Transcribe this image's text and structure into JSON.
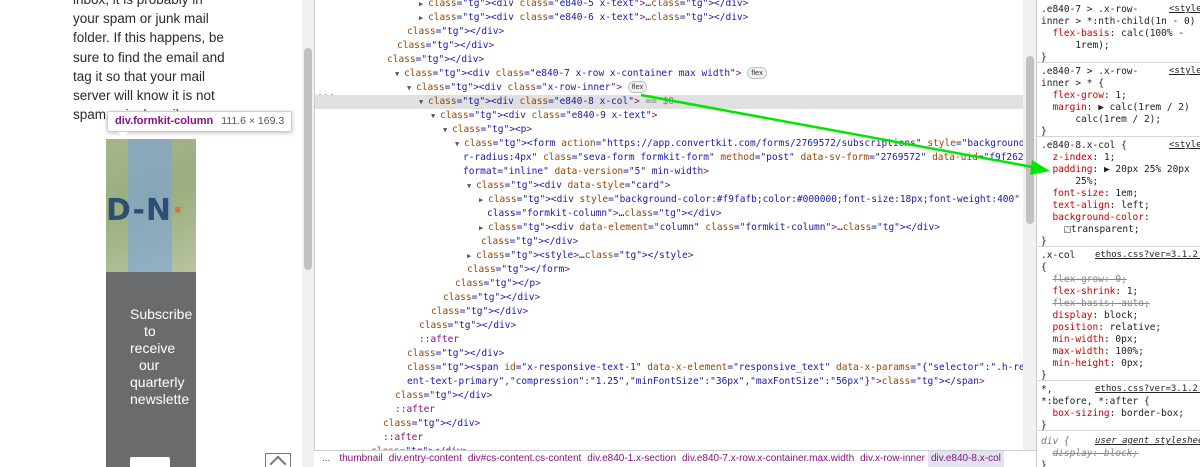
{
  "page": {
    "text_lines": [
      "inbox, it is probably in",
      "your spam or junk mail",
      "folder. If this happens, be",
      "sure to find the email and",
      "tag it so that your mail",
      "server will know it is not",
      "spam or junk mail."
    ],
    "tooltip_selector": "div.formkit-column",
    "tooltip_dims": "111.6 × 169.3",
    "image_text": "D-N",
    "image_text_end": "·",
    "embed_lines": [
      "Subscribe",
      "to",
      "receive",
      "our",
      "quarterly",
      "newslette"
    ],
    "colors": {
      "embed_bg": "#6a6b6d",
      "arrow": "#00e600"
    }
  },
  "elements": {
    "ellipsis": "···",
    "lines": [
      {
        "indent": 104,
        "tri": "▶",
        "html": "&lt;div class=&quot;e840-5 x-text&quot;&gt;…&lt;/div&gt;"
      },
      {
        "indent": 104,
        "tri": "▶",
        "html": "&lt;div class=&quot;e840-6 x-text&quot;&gt;…&lt;/div&gt;"
      },
      {
        "indent": 92,
        "tri": "",
        "html": "&lt;/div&gt;"
      },
      {
        "indent": 82,
        "tri": "",
        "html": "&lt;/div&gt;"
      },
      {
        "indent": 72,
        "tri": "",
        "html": "&lt;/div&gt;"
      },
      {
        "indent": 80,
        "tri": "▼",
        "html": "&lt;div class=&quot;e840-7 x-row x-container max width&quot;&gt;",
        "badge": "flex"
      },
      {
        "indent": 92,
        "tri": "▼",
        "html": "&lt;div class=&quot;x-row-inner&quot;&gt;",
        "badge": "flex"
      },
      {
        "indent": 104,
        "tri": "▼",
        "html": "&lt;div class=&quot;e840-8 x-col&quot;&gt;",
        "suffix": " == $0",
        "sel": true
      },
      {
        "indent": 116,
        "tri": "▼",
        "html": "&lt;div class=&quot;e840-9 x-text&quot;&gt;"
      },
      {
        "indent": 128,
        "tri": "▼",
        "html": "&lt;p&gt;"
      },
      {
        "indent": 140,
        "tri": "▼",
        "html": "&lt;form action=&quot;https://app.convertkit.com/forms/2769572/subscriptions&quot; style=&quot;background-color:#6a6b6d;borde"
      },
      {
        "indent": 148,
        "tri": "",
        "html": "r-radius:4px&quot; class=&quot;seva-form formkit-form&quot; method=&quot;post&quot; data-sv-form=&quot;2769572&quot; data-uid=&quot;f9f2627301&quot; data-"
      },
      {
        "indent": 148,
        "tri": "",
        "html": "format=&quot;inline&quot; data-version=&quot;5&quot; min-width&gt;"
      },
      {
        "indent": 152,
        "tri": "▼",
        "html": "&lt;div data-style=&quot;card&quot;&gt;"
      },
      {
        "indent": 164,
        "tri": "▶",
        "html": "&lt;div style=&quot;background-color:#f9fafb;color:#000000;font-size:18px;font-weight:400&quot; data-element=&quot;column&quot;"
      },
      {
        "indent": 172,
        "tri": "",
        "html": "class=&quot;formkit-column&quot;&gt;…&lt;/div&gt;"
      },
      {
        "indent": 164,
        "tri": "▶",
        "html": "&lt;div data-element=&quot;column&quot; class=&quot;formkit-column&quot;&gt;…&lt;/div&gt;"
      },
      {
        "indent": 166,
        "tri": "",
        "html": "&lt;/div&gt;"
      },
      {
        "indent": 152,
        "tri": "▶",
        "html": "&lt;style&gt;…&lt;/style&gt;"
      },
      {
        "indent": 152,
        "tri": "",
        "html": "&lt;/form&gt;"
      },
      {
        "indent": 140,
        "tri": "",
        "html": "&lt;/p&gt;"
      },
      {
        "indent": 128,
        "tri": "",
        "html": "&lt;/div&gt;"
      },
      {
        "indent": 116,
        "tri": "",
        "html": "&lt;/div&gt;"
      },
      {
        "indent": 104,
        "tri": "",
        "html": "&lt;/div&gt;"
      },
      {
        "indent": 104,
        "tri": "",
        "html": "::after",
        "pseudo": true
      },
      {
        "indent": 92,
        "tri": "",
        "html": "&lt;/div&gt;"
      },
      {
        "indent": 92,
        "tri": "",
        "html": "&lt;span id=&quot;x-responsive-text-1&quot; data-x-element=&quot;responsive_text&quot; data-x-params=&quot;{&quot;selector&quot;:&quot;.h-responsive .x-text-cont"
      },
      {
        "indent": 92,
        "tri": "",
        "html": "ent-text-primary&quot;,&quot;compression&quot;:&quot;1.25&quot;,&quot;minFontSize&quot;:&quot;36px&quot;,&quot;maxFontSize&quot;:&quot;56px&quot;}&quot;&gt;&lt;/span&gt;"
      },
      {
        "indent": 80,
        "tri": "",
        "html": "&lt;/div&gt;"
      },
      {
        "indent": 80,
        "tri": "",
        "html": "::after",
        "pseudo": true
      },
      {
        "indent": 68,
        "tri": "",
        "html": "&lt;/div&gt;"
      },
      {
        "indent": 68,
        "tri": "",
        "html": "::after",
        "pseudo": true
      },
      {
        "indent": 56,
        "tri": "",
        "html": "&lt;/div&gt;"
      }
    ]
  },
  "breadcrumbs": {
    "more": "...",
    "items": [
      "thumbnail",
      "div.entry-content",
      "div#cs-content.cs-content",
      "div.e840-1.x-section",
      "div.e840-7.x-row.x-container.max.width",
      "div.x-row-inner",
      "div.e840-8.x-col"
    ],
    "current_index": 6
  },
  "styles": {
    "lines": [
      {
        "t": 4,
        "html": ".e840-7 &gt; .x-row-",
        "src": "&lt;style"
      },
      {
        "t": 16,
        "html": "inner &gt; *:nth-child(1n - 0) {"
      },
      {
        "t": 28,
        "html": "&nbsp;&nbsp;<span class='prop'>flex-basis</span>: calc(100% -"
      },
      {
        "t": 40,
        "html": "&nbsp;&nbsp;&nbsp;&nbsp;&nbsp;&nbsp;1rem);"
      },
      {
        "t": 52,
        "html": "}"
      },
      {
        "hr": true,
        "t": 62
      },
      {
        "t": 66,
        "html": ".e840-7 &gt; .x-row-",
        "src": "&lt;style"
      },
      {
        "t": 78,
        "html": "inner &gt; * {"
      },
      {
        "t": 90,
        "html": "&nbsp;&nbsp;<span class='prop'>flex-grow</span>: 1;"
      },
      {
        "t": 102,
        "html": "&nbsp;&nbsp;<span class='prop'>margin</span>: ▶ calc(1rem / 2)"
      },
      {
        "t": 114,
        "html": "&nbsp;&nbsp;&nbsp;&nbsp;&nbsp;&nbsp;calc(1rem / 2);"
      },
      {
        "t": 126,
        "html": "}"
      },
      {
        "hr": true,
        "t": 136
      },
      {
        "t": 140,
        "html": ".e840-8.x-col {",
        "src": "&lt;style"
      },
      {
        "t": 152,
        "html": "&nbsp;&nbsp;<span class='prop'>z-index</span>: 1;"
      },
      {
        "t": 164,
        "html": "&nbsp;&nbsp;<span class='prop'>padding</span>: ▶ 20px 25% 20px"
      },
      {
        "t": 176,
        "html": "&nbsp;&nbsp;&nbsp;&nbsp;&nbsp;&nbsp;25%;"
      },
      {
        "t": 188,
        "html": "&nbsp;&nbsp;<span class='prop'>font-size</span>: 1em;"
      },
      {
        "t": 200,
        "html": "&nbsp;&nbsp;<span class='prop'>text-align</span>: left;"
      },
      {
        "t": 212,
        "html": "&nbsp;&nbsp;<span class='prop'>background-color</span>:"
      },
      {
        "t": 224,
        "html": "&nbsp;&nbsp;&nbsp;&nbsp;<span class='swatch'></span>transparent;"
      },
      {
        "t": 236,
        "html": "}"
      },
      {
        "hr": true,
        "t": 246
      },
      {
        "t": 250,
        "html": ".x-col",
        "src": "ethos.css?ver=3.1.2:1",
        "srcLeft": 54
      },
      {
        "t": 262,
        "html": "{"
      },
      {
        "t": 274,
        "html": "&nbsp;&nbsp;<span class='strike'><span class='prop'>flex-grow</span>: 0;</span>"
      },
      {
        "t": 286,
        "html": "&nbsp;&nbsp;<span class='prop'>flex-shrink</span>: 1;"
      },
      {
        "t": 298,
        "html": "&nbsp;&nbsp;<span class='strike'><span class='prop'>flex-basis</span>: auto;</span>"
      },
      {
        "t": 310,
        "html": "&nbsp;&nbsp;<span class='prop'>display</span>: block;"
      },
      {
        "t": 322,
        "html": "&nbsp;&nbsp;<span class='prop'>position</span>: relative;"
      },
      {
        "t": 334,
        "html": "&nbsp;&nbsp;<span class='prop'>min-width</span>: 0px;"
      },
      {
        "t": 346,
        "html": "&nbsp;&nbsp;<span class='prop'>max-width</span>: 100%;"
      },
      {
        "t": 358,
        "html": "&nbsp;&nbsp;<span class='prop'>min-height</span>: 0px;"
      },
      {
        "t": 370,
        "html": "}"
      },
      {
        "hr": true,
        "t": 380
      },
      {
        "t": 384,
        "html": "*,",
        "src": "ethos.css?ver=3.1.2:1",
        "srcLeft": 54
      },
      {
        "t": 396,
        "html": "*:before, *:after {"
      },
      {
        "t": 408,
        "html": "&nbsp;&nbsp;<span class='prop'>box-sizing</span>: border-box;"
      },
      {
        "t": 420,
        "html": "}"
      },
      {
        "hr": true,
        "t": 430
      },
      {
        "t": 436,
        "html": "div {",
        "src": "user agent styleshee",
        "srcLeft": 54,
        "ua": true
      },
      {
        "t": 448,
        "html": "&nbsp;&nbsp;<span class='strike'>display: block;</span>",
        "ua": true
      },
      {
        "t": 460,
        "html": "}"
      }
    ]
  }
}
